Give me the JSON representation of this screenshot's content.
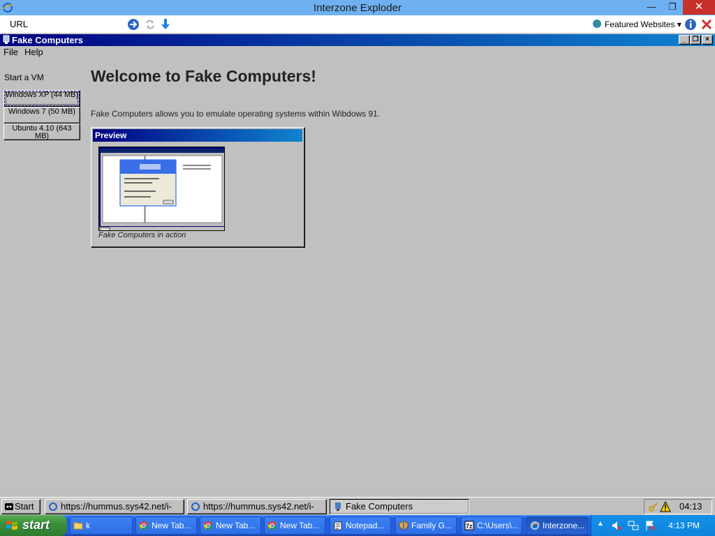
{
  "outer_window": {
    "title": "Interzone Exploder",
    "minimize": "—",
    "restore": "❐",
    "close": "✕"
  },
  "urlbar": {
    "label": "URL",
    "featured": "Featured Websites ▾"
  },
  "app_window": {
    "title": "Fake Computers",
    "menu": [
      "File",
      "Help"
    ]
  },
  "sidebar": {
    "heading": "Start a VM",
    "vms": [
      {
        "label": "Windows XP (44 MB)"
      },
      {
        "label": "Windows 7 (50 MB)"
      },
      {
        "label": "Ubuntu 4.10 (643 MB)"
      }
    ]
  },
  "main": {
    "heading": "Welcome to Fake Computers!",
    "description": "Fake Computers allows you to emulate operating systems within Wibdows 91.",
    "preview_title": "Preview",
    "preview_caption": "Fake Computers in action"
  },
  "inner_taskbar": {
    "start": "Start",
    "tasks": [
      {
        "label": "https://hummus.sys42.net/i-"
      },
      {
        "label": "https://hummus.sys42.net/i-"
      },
      {
        "label": "Fake Computers"
      }
    ],
    "clock": "04:13"
  },
  "host_taskbar": {
    "start": "start",
    "tasks": [
      {
        "label": "k"
      },
      {
        "label": "New Tab..."
      },
      {
        "label": "New Tab..."
      },
      {
        "label": "New Tab..."
      },
      {
        "label": "Notepad..."
      },
      {
        "label": "Family G..."
      },
      {
        "label": "C:\\Users\\..."
      },
      {
        "label": "Interzone..."
      }
    ],
    "clock": "4:13 PM"
  },
  "colors": {
    "outer_titlebar": "#6fb1f0",
    "win9x_title_start": "#000080",
    "win9x_title_end": "#1084d0",
    "desktop_gray": "#c0c0c0",
    "xp_taskbar": "#245edb",
    "xp_start": "#3c8f3c"
  }
}
